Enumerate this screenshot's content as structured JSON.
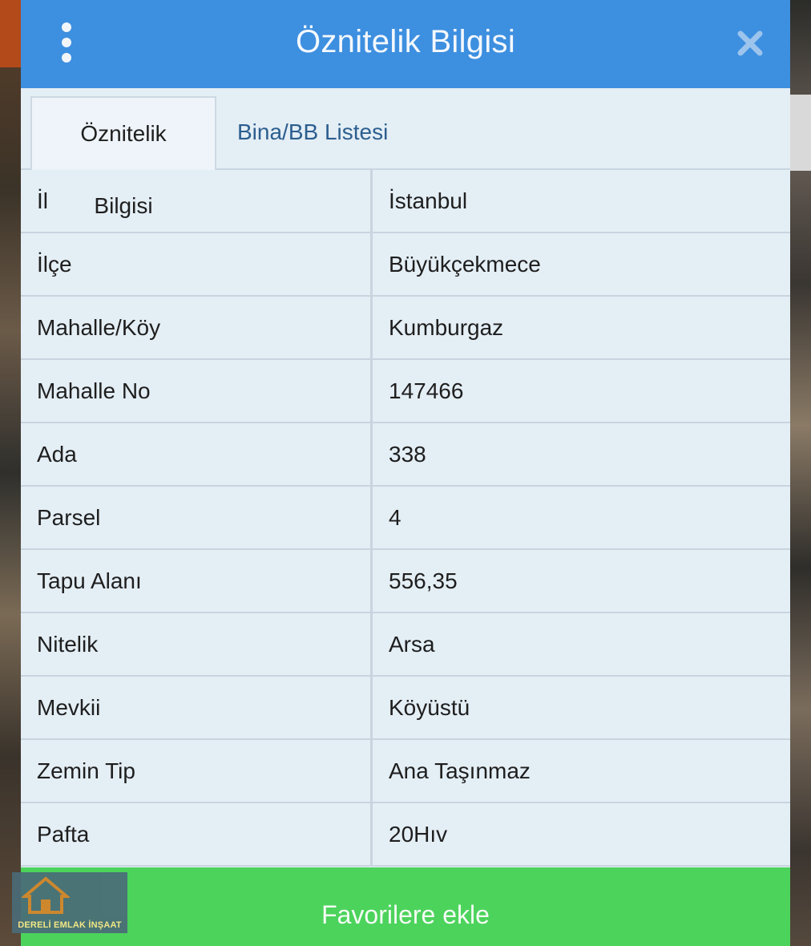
{
  "header": {
    "title": "Öznitelik Bilgisi",
    "menu_icon": "vertical-dots-icon",
    "close_icon": "close-icon"
  },
  "tabs": [
    {
      "label": "Öznitelik Bilgisi",
      "active": true
    },
    {
      "label": "Bina/BB Listesi",
      "active": false
    }
  ],
  "rows": [
    {
      "key": "İl",
      "value": "İstanbul"
    },
    {
      "key": "İlçe",
      "value": "Büyükçekmece"
    },
    {
      "key": "Mahalle/Köy",
      "value": "Kumburgaz"
    },
    {
      "key": "Mahalle No",
      "value": "147466"
    },
    {
      "key": "Ada",
      "value": "338"
    },
    {
      "key": "Parsel",
      "value": "4"
    },
    {
      "key": "Tapu Alanı",
      "value": "556,35"
    },
    {
      "key": "Nitelik",
      "value": "Arsa"
    },
    {
      "key": "Mevkii",
      "value": "Köyüstü"
    },
    {
      "key": "Zemin Tip",
      "value": "Ana Taşınmaz"
    },
    {
      "key": "Pafta",
      "value": "20Hıv"
    }
  ],
  "footer": {
    "button_label": "Favorilere ekle"
  },
  "logo": {
    "text": "DERELİ EMLAK İNŞAAT"
  },
  "colors": {
    "header_blue": "#3d8fe0",
    "footer_green": "#4cd35c",
    "panel_bg": "#e4eef5"
  }
}
